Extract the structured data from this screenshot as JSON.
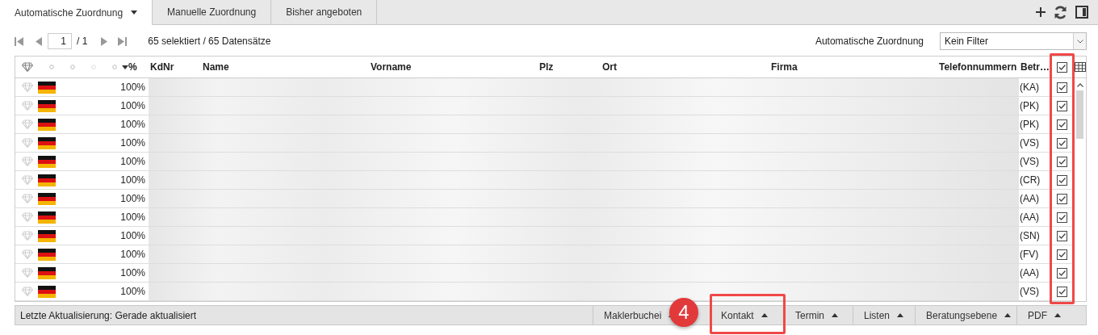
{
  "tabs": [
    {
      "label": "Automatische Zuordnung",
      "selected": true,
      "has_menu": true
    },
    {
      "label": "Manuelle Zuordnung",
      "selected": false,
      "has_menu": false
    },
    {
      "label": "Bisher angeboten",
      "selected": false,
      "has_menu": false
    }
  ],
  "pager": {
    "page": "1",
    "total": "/ 1",
    "summary": "65 selektiert / 65 Datensätze"
  },
  "filter": {
    "label": "Automatische Zuordnung",
    "value": "Kein Filter"
  },
  "table": {
    "sort_label": "%",
    "columns": [
      "KdNr",
      "Name",
      "Vorname",
      "Plz",
      "Ort",
      "Firma",
      "Telefonnummern",
      "Betr…"
    ],
    "all_checked": true,
    "rows": [
      {
        "match": "100%",
        "code": "(KA)",
        "checked": true
      },
      {
        "match": "100%",
        "code": "(PK)",
        "checked": true
      },
      {
        "match": "100%",
        "code": "(PK)",
        "checked": true
      },
      {
        "match": "100%",
        "code": "(VS)",
        "checked": true
      },
      {
        "match": "100%",
        "code": "(VS)",
        "checked": true
      },
      {
        "match": "100%",
        "code": "(CR)",
        "checked": true
      },
      {
        "match": "100%",
        "code": "(AA)",
        "checked": true
      },
      {
        "match": "100%",
        "code": "(AA)",
        "checked": true
      },
      {
        "match": "100%",
        "code": "(SN)",
        "checked": true
      },
      {
        "match": "100%",
        "code": "(FV)",
        "checked": true
      },
      {
        "match": "100%",
        "code": "(AA)",
        "checked": true
      },
      {
        "match": "100%",
        "code": "(VS)",
        "checked": true
      }
    ]
  },
  "status": "Letzte Aktualisierung: Gerade aktualisiert",
  "footer_buttons": [
    "Maklerbuchei",
    "Kontakt",
    "Termin",
    "Listen",
    "Beratungsebene",
    "PDF"
  ],
  "annotation": {
    "badge": "4"
  }
}
